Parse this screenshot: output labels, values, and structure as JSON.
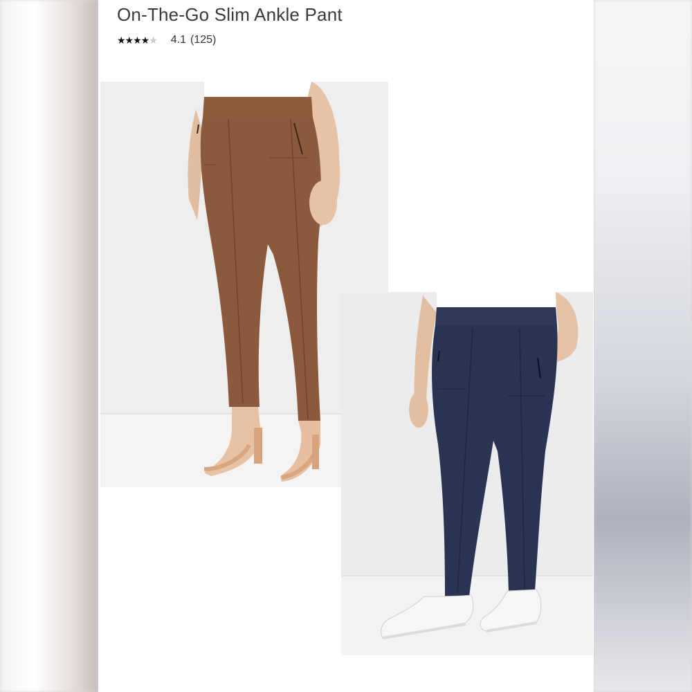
{
  "product": {
    "title": "On-The-Go Slim Ankle Pant",
    "rating": {
      "stars_filled": 4,
      "stars_total": 5,
      "value": "4.1",
      "count": "(125)"
    }
  },
  "images": [
    {
      "color": "#8b5a3c",
      "subject": "brown pants with nude heeled sandals"
    },
    {
      "color": "#2b3352",
      "subject": "navy pants with white sneakers"
    }
  ]
}
